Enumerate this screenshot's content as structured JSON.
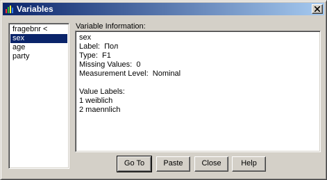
{
  "window": {
    "title": "Variables"
  },
  "variables_list": {
    "items": [
      {
        "label": "fragebnr <",
        "selected": false
      },
      {
        "label": "sex",
        "selected": true
      },
      {
        "label": "age",
        "selected": false
      },
      {
        "label": "party",
        "selected": false
      }
    ]
  },
  "info": {
    "heading": "Variable Information:",
    "lines": [
      "sex",
      "Label:  Пол",
      "Type:  F1",
      "Missing Values:  0",
      "Measurement Level:  Nominal",
      "",
      "Value Labels:",
      "1 weiblich",
      "2 maennlich"
    ]
  },
  "buttons": {
    "goto_label": "Go To",
    "paste_label": "Paste",
    "close_label": "Close",
    "help_label": "Help"
  },
  "colors": {
    "titlebar_start": "#0a246a",
    "titlebar_end": "#a6caf0",
    "selection": "#0a246a",
    "dialog_face": "#d4d0c8"
  }
}
